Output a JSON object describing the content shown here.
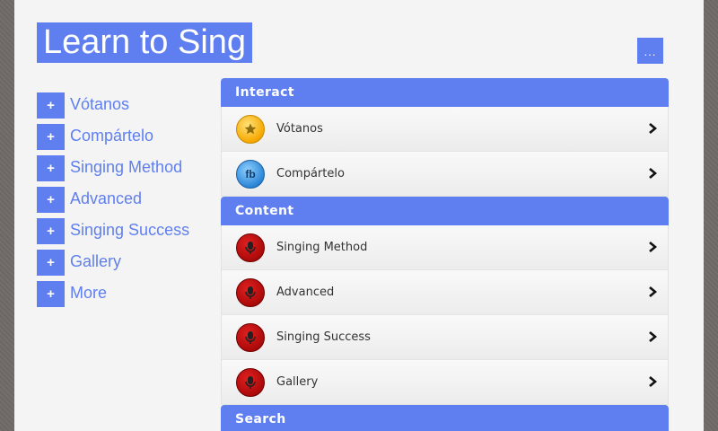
{
  "header": {
    "title": "Learn to Sing",
    "menu_label": "..."
  },
  "sidebar": {
    "items": [
      {
        "plus": "+",
        "label": "Vótanos"
      },
      {
        "plus": "+",
        "label": "Compártelo"
      },
      {
        "plus": "+",
        "label": "Singing Method"
      },
      {
        "plus": "+",
        "label": "Advanced"
      },
      {
        "plus": "+",
        "label": "Singing Success"
      },
      {
        "plus": "+",
        "label": "Gallery"
      },
      {
        "plus": "+",
        "label": "More"
      }
    ]
  },
  "sections": [
    {
      "title": "Interact",
      "items": [
        {
          "label": "Vótanos",
          "icon": "star-icon"
        },
        {
          "label": "Compártelo",
          "icon": "facebook-icon",
          "icon_text": "fb"
        }
      ]
    },
    {
      "title": "Content",
      "items": [
        {
          "label": "Singing Method",
          "icon": "microphone-icon"
        },
        {
          "label": "Advanced",
          "icon": "microphone-icon"
        },
        {
          "label": "Singing Success",
          "icon": "microphone-icon"
        },
        {
          "label": "Gallery",
          "icon": "microphone-icon"
        }
      ]
    },
    {
      "title": "Search",
      "items": []
    }
  ],
  "colors": {
    "accent": "#5f7ff0",
    "background": "#6f6a68",
    "page": "#f4f4f4"
  }
}
